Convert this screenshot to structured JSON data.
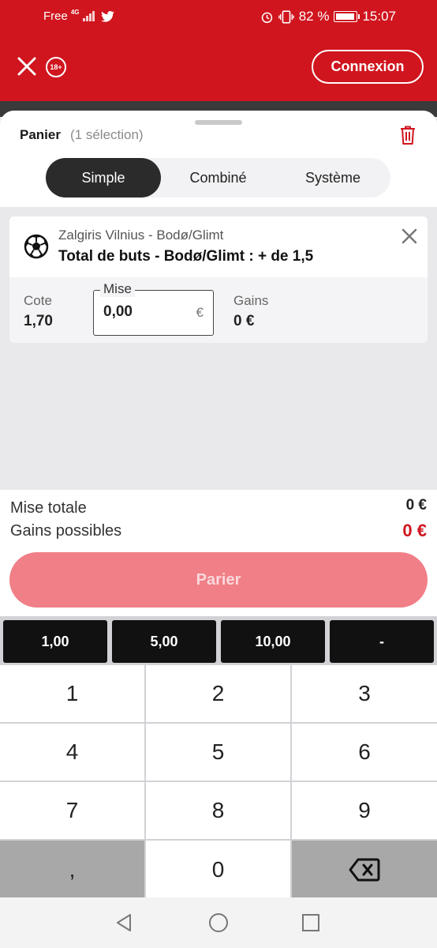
{
  "status_bar": {
    "carrier": "Free",
    "network": "4G",
    "battery": "82 %",
    "time": "15:07"
  },
  "header": {
    "age_badge": "18+",
    "login_label": "Connexion"
  },
  "basket": {
    "title": "Panier",
    "selection_count": "(1 sélection)",
    "tabs": [
      {
        "label": "Simple",
        "active": true
      },
      {
        "label": "Combiné",
        "active": false
      },
      {
        "label": "Système",
        "active": false
      }
    ]
  },
  "bet": {
    "match": "Zalgiris Vilnius - Bodø/Glimt",
    "market": "Total de buts - Bodø/Glimt : + de 1,5",
    "odds_label": "Cote",
    "odds_value": "1,70",
    "stake_label": "Mise",
    "stake_value": "0,00",
    "currency": "€",
    "gains_label": "Gains",
    "gains_value": "0 €"
  },
  "totals": {
    "total_stake_label": "Mise totale",
    "total_stake_value": "0 €",
    "potential_gains_label": "Gains possibles",
    "potential_gains_value": "0 €",
    "bet_button": "Parier"
  },
  "quick_amounts": [
    "1,00",
    "5,00",
    "10,00",
    "-"
  ],
  "keypad": {
    "keys": [
      "1",
      "2",
      "3",
      "4",
      "5",
      "6",
      "7",
      "8",
      "9",
      ",",
      "0"
    ]
  },
  "colors": {
    "brand_red": "#d0151e",
    "bet_button_disabled": "#f07f87",
    "gains_red": "#d0151e"
  }
}
